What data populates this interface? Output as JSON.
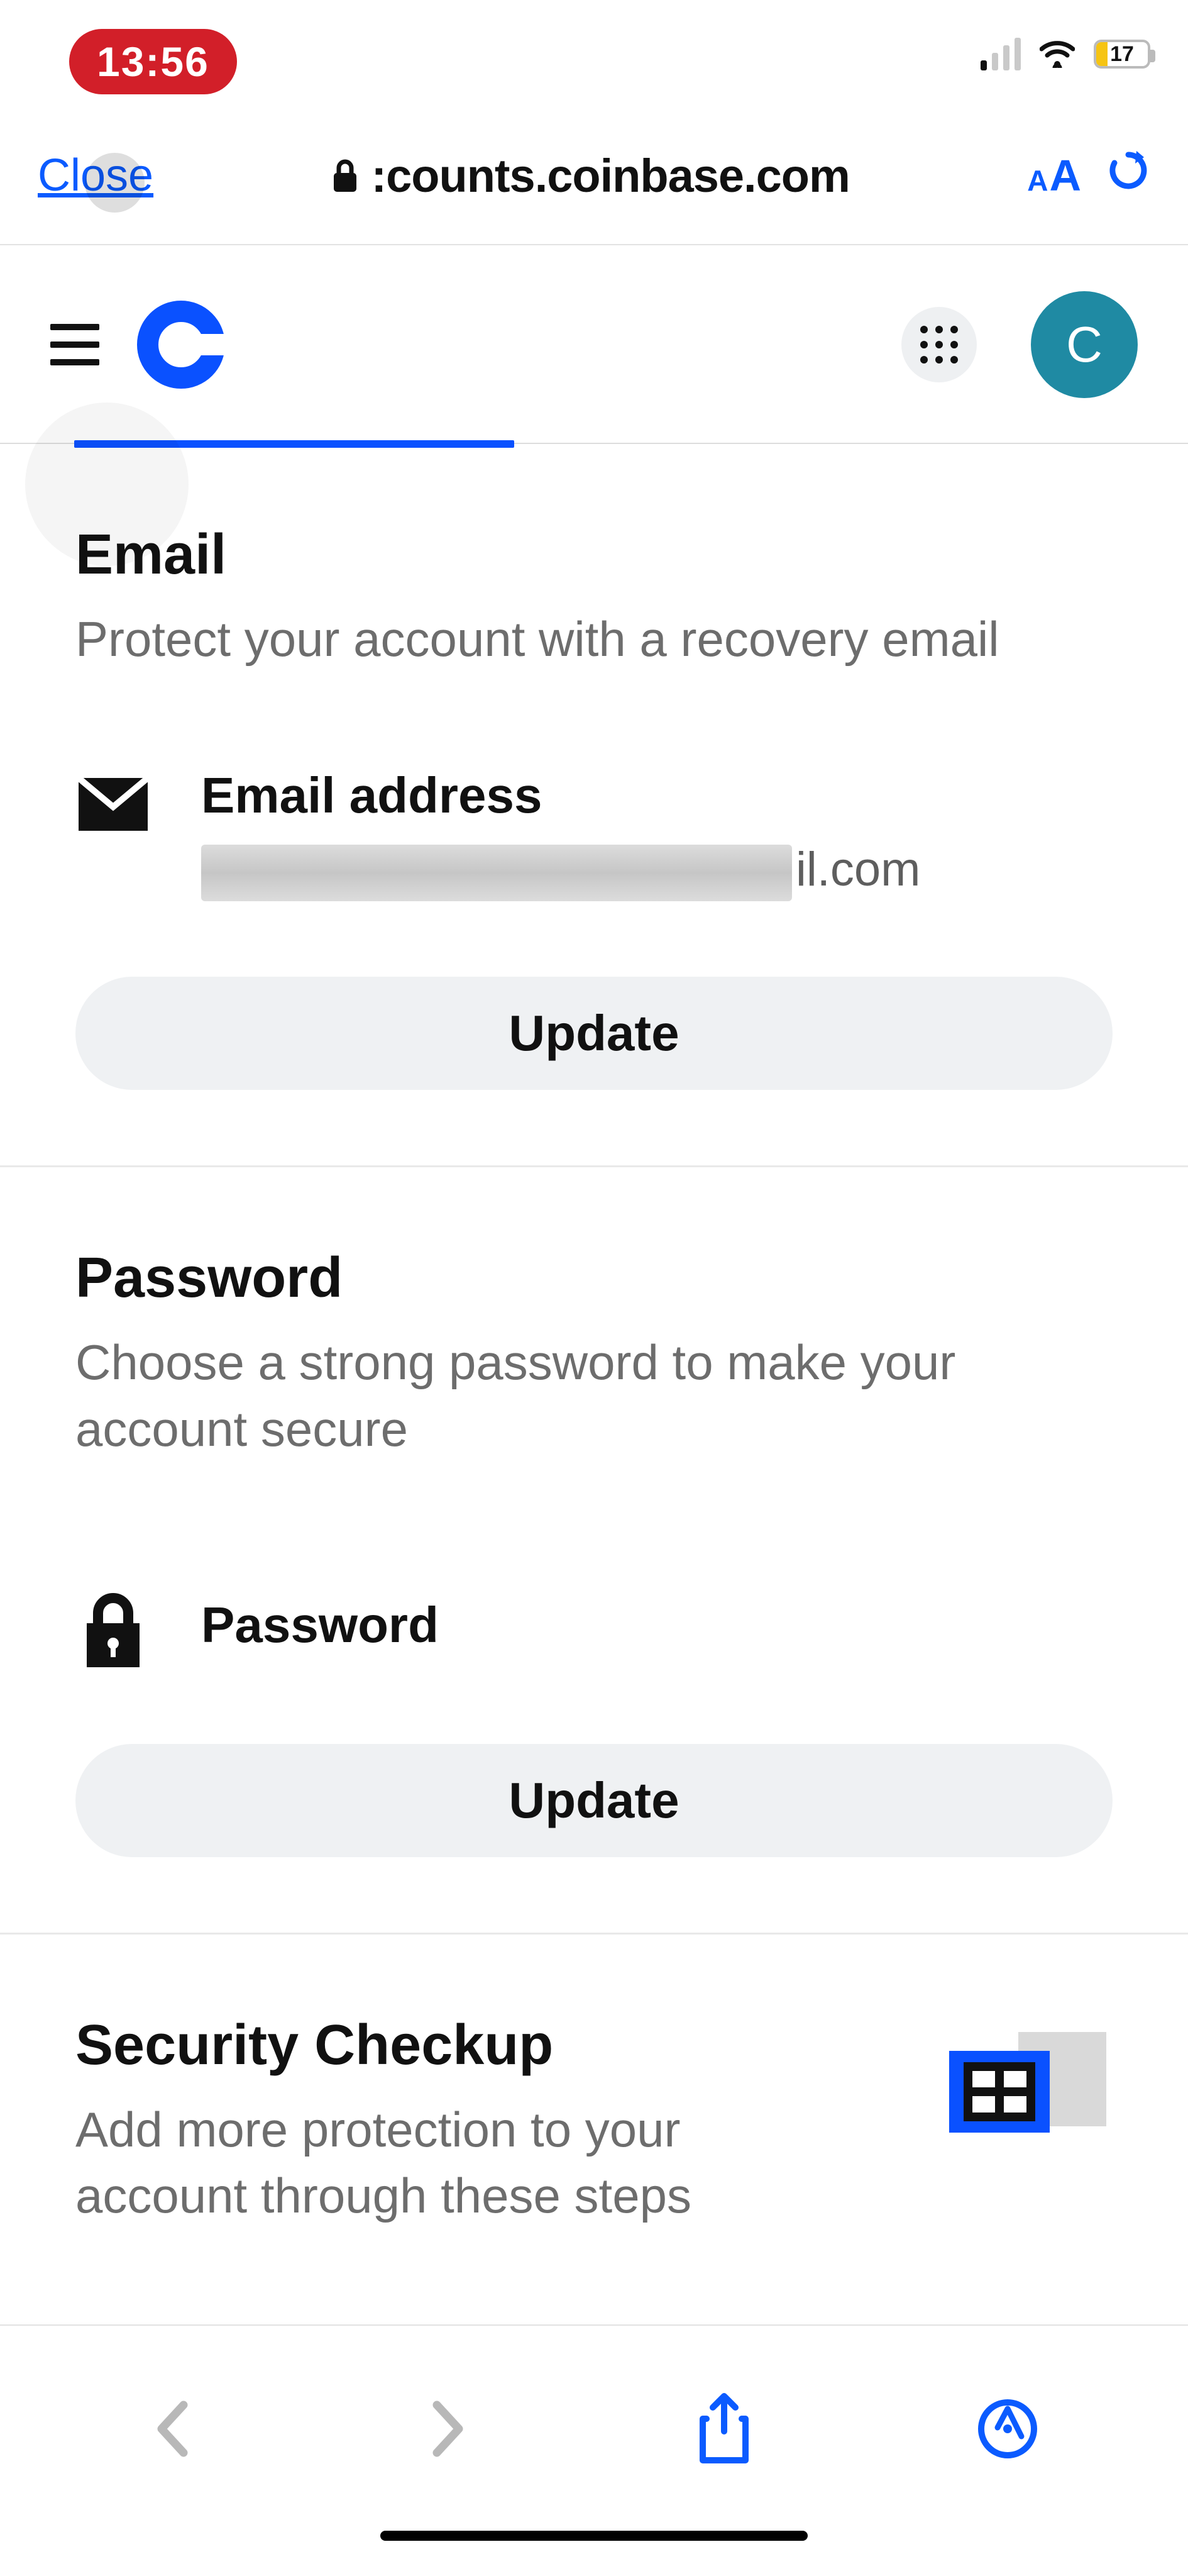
{
  "status": {
    "time": "13:56",
    "battery_pct": "17"
  },
  "browser": {
    "close": "Close",
    "url": ":counts.coinbase.com",
    "avatar_initial": "C"
  },
  "sections": {
    "email": {
      "title": "Email",
      "subtitle": "Protect your account with a recovery email",
      "field_label": "Email address",
      "value_suffix": "il.com",
      "button": "Update"
    },
    "password": {
      "title": "Password",
      "subtitle": "Choose a strong password to make your account secure",
      "field_label": "Password",
      "button": "Update"
    },
    "checkup": {
      "title": "Security Checkup",
      "subtitle": "Add more protection to your account through these steps"
    }
  }
}
